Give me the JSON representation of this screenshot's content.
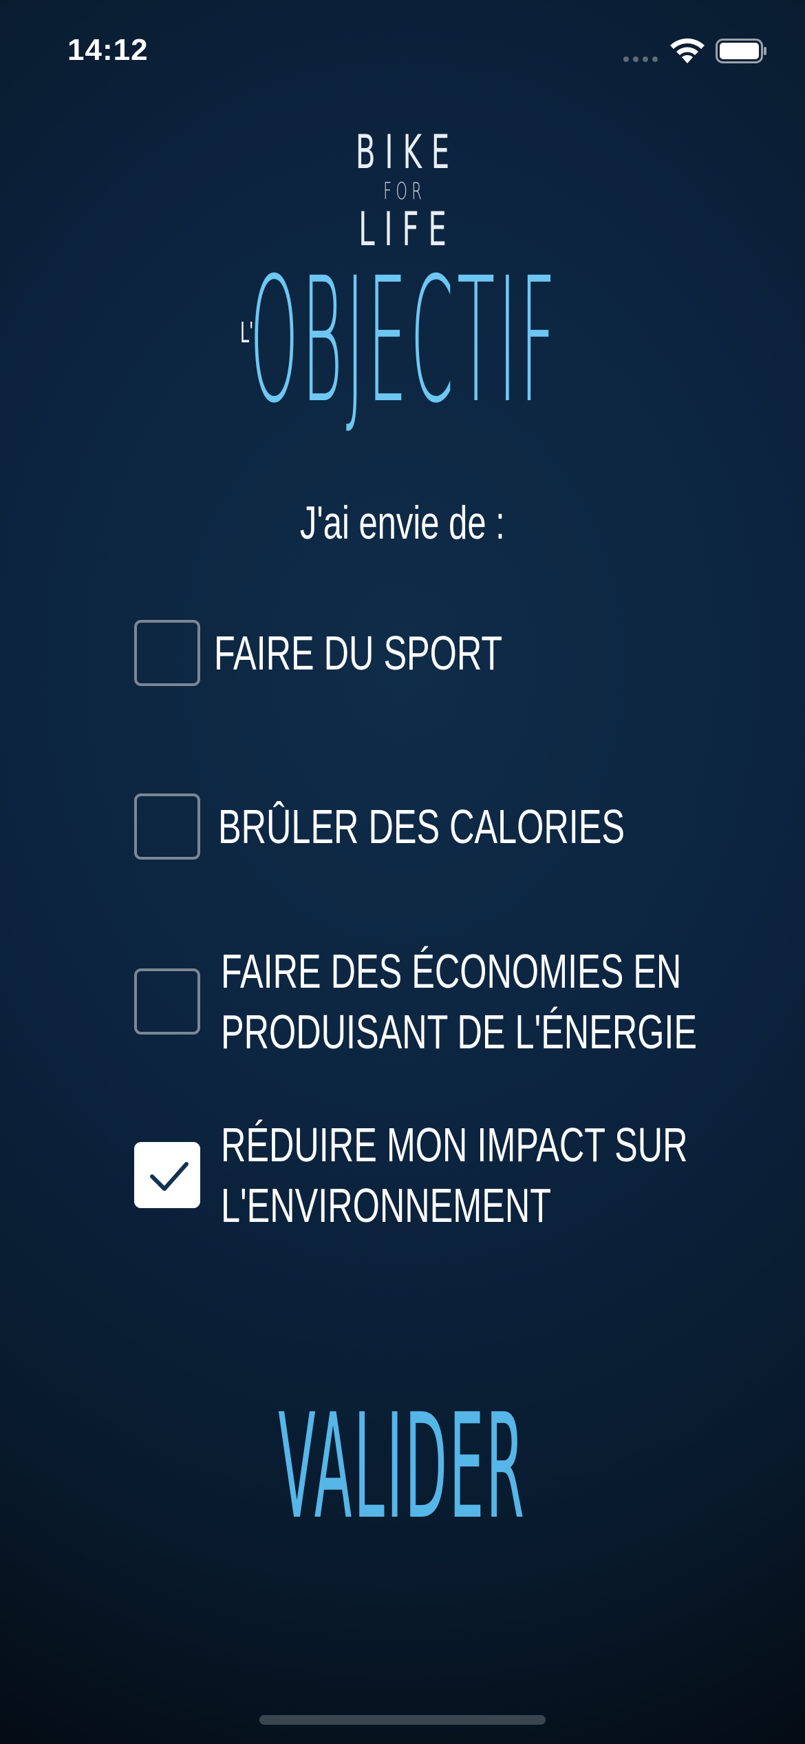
{
  "status_bar": {
    "time": "14:12",
    "wifi_icon": "wifi-icon",
    "battery_icon": "battery-icon"
  },
  "logo": {
    "line1": "BIKE",
    "line2": "FOR",
    "line3": "LIFE"
  },
  "heading": {
    "prefix": "L'",
    "main": "OBJECTIF"
  },
  "subtitle": "J'ai envie de :",
  "options": [
    {
      "line1": "FAIRE DU SPORT",
      "line2": "",
      "checked": false
    },
    {
      "line1": "BRÛLER DES CALORIES",
      "line2": "",
      "checked": false
    },
    {
      "line1": "FAIRE DES ÉCONOMIES EN",
      "line2": "PRODUISANT DE L'ÉNERGIE",
      "checked": false
    },
    {
      "line1": "RÉDUIRE MON IMPACT SUR",
      "line2": "L'ENVIRONNEMENT",
      "checked": true
    }
  ],
  "validate_label": "VALIDER",
  "colors": {
    "accent": "#6ec7f2",
    "button": "#56b6e8",
    "background": "#0c2440",
    "checkbox_border": "#7c8793"
  }
}
